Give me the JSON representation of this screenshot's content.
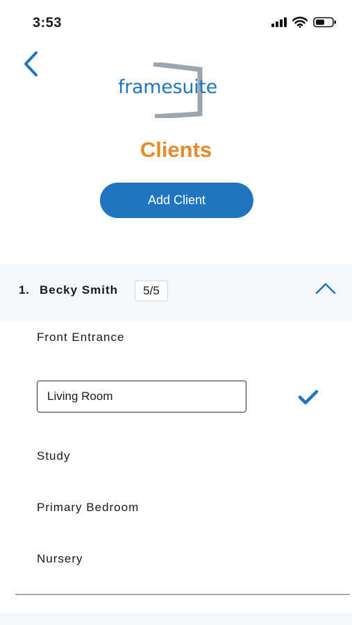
{
  "status_bar": {
    "time": "3:53",
    "icons": [
      "cellular-signal-icon",
      "wifi-icon",
      "battery-icon"
    ]
  },
  "header": {
    "back_icon": "chevron-left-icon",
    "logo_text": "framesuite",
    "title": "Clients",
    "add_button_label": "Add Client"
  },
  "client": {
    "number": "1.",
    "name": "Becky Smith",
    "badge": "5/5",
    "expanded": true,
    "rooms": [
      {
        "label": "Front Entrance"
      },
      {
        "label": "Living Room",
        "editing": true
      },
      {
        "label": "Study"
      },
      {
        "label": "Primary Bedroom"
      },
      {
        "label": "Nursery"
      }
    ]
  },
  "colors": {
    "brand_blue": "#1f75bf",
    "title_orange": "#e58c2e",
    "header_bg": "#f3f9fc",
    "logo_frame_gray": "#9aa6b0"
  }
}
